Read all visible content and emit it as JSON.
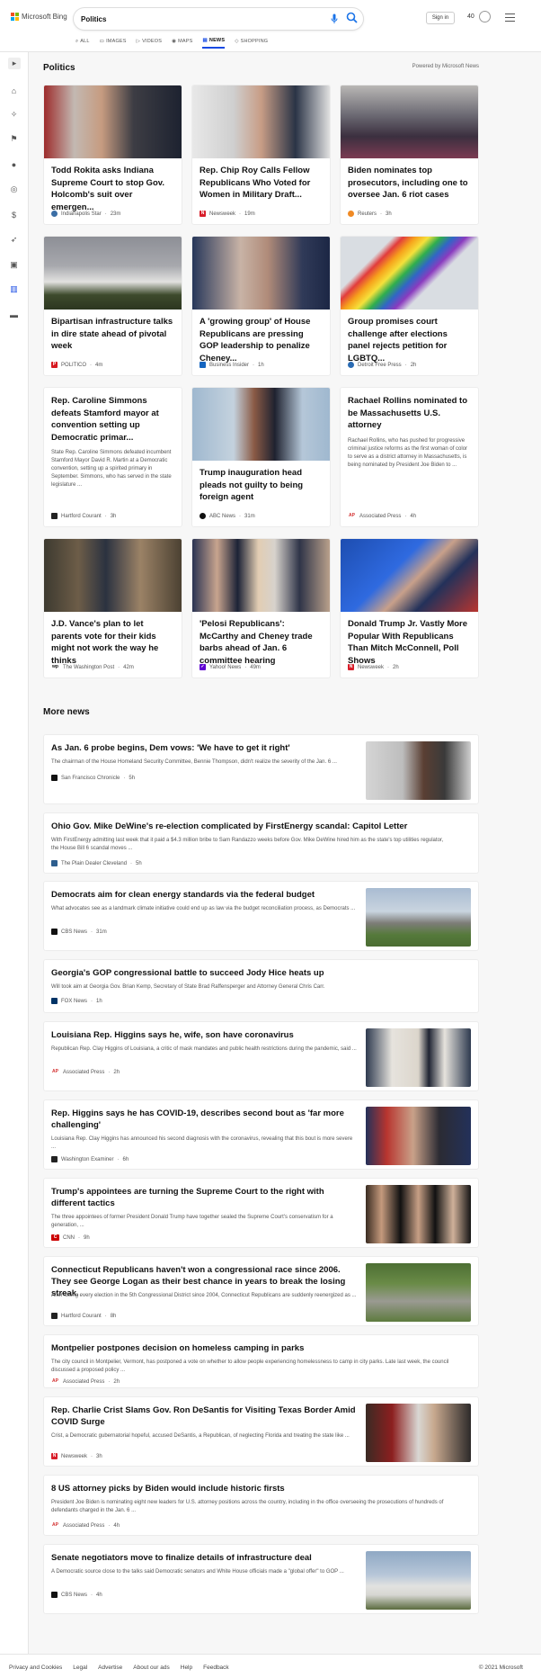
{
  "brand": {
    "name": "Microsoft Bing"
  },
  "search": {
    "query": "Politics"
  },
  "header": {
    "sign_in": "Sign in",
    "rewards_points": "40"
  },
  "tabs": [
    {
      "label": "ALL"
    },
    {
      "label": "IMAGES"
    },
    {
      "label": "VIDEOS"
    },
    {
      "label": "MAPS"
    },
    {
      "label": "NEWS",
      "active": true
    },
    {
      "label": "SHOPPING"
    }
  ],
  "section": {
    "title": "Politics",
    "powered_by": "Powered by Microsoft News"
  },
  "cards": [
    {
      "title": "Todd Rokita asks Indiana Supreme Court to stop Gov. Holcomb's suit over emergen...",
      "source": "Indianapolis Star",
      "time": "23m"
    },
    {
      "title": "Rep. Chip Roy Calls Fellow Republicans Who Voted for Women in Military Draft...",
      "source": "Newsweek",
      "time": "19m"
    },
    {
      "title": "Biden nominates top prosecutors, including one to oversee Jan. 6 riot cases",
      "source": "Reuters",
      "time": "3h"
    },
    {
      "title": "Bipartisan infrastructure talks in dire state ahead of pivotal week",
      "source": "POLITICO",
      "time": "4m"
    },
    {
      "title": "A 'growing group' of House Republicans are pressing GOP leadership to penalize Cheney...",
      "source": "Business Insider",
      "time": "1h"
    },
    {
      "title": "Group promises court challenge after elections panel rejects petition for LGBTQ...",
      "source": "Detroit Free Press",
      "time": "2h"
    },
    {
      "title": "Rep. Caroline Simmons defeats Stamford mayor at convention setting up Democratic primar...",
      "desc": "State Rep. Caroline Simmons defeated incumbent Stamford Mayor David R. Martin at a Democratic convention, setting up a spirited primary in September. Simmons, who has served in the state legislature ...",
      "source": "Hartford Courant",
      "time": "3h"
    },
    {
      "title": "Trump inauguration head pleads not guilty to being foreign agent",
      "source": "ABC News",
      "time": "31m"
    },
    {
      "title": "Rachael Rollins nominated to be Massachusetts U.S. attorney",
      "desc": "Rachael Rollins, who has pushed for progressive criminal justice reforms as the first woman of color to serve as a district attorney in Massachusetts, is being nominated by President Joe Biden to ...",
      "source": "Associated Press",
      "time": "4h"
    },
    {
      "title": "J.D. Vance's plan to let parents vote for their kids might not work the way he thinks",
      "source": "The Washington Post",
      "time": "42m"
    },
    {
      "title": "'Pelosi Republicans': McCarthy and Cheney trade barbs ahead of Jan. 6 committee hearing",
      "source": "Yahoo! News",
      "time": "49m"
    },
    {
      "title": "Donald Trump Jr. Vastly More Popular With Republicans Than Mitch McConnell, Poll Shows",
      "source": "Newsweek",
      "time": "2h"
    }
  ],
  "more_news": {
    "title": "More news",
    "items": [
      {
        "title": "As Jan. 6 probe begins, Dem vows: 'We have to get it right'",
        "desc": "The chairman of the House Homeland Security Committee, Bennie Thompson, didn't realize the severity of the Jan. 6 ...",
        "source": "San Francisco Chronicle",
        "time": "5h"
      },
      {
        "title": "Ohio Gov. Mike DeWine's re-election complicated by FirstEnergy scandal: Capitol Letter",
        "desc": "With FirstEnergy admitting last week that it paid a $4.3 million bribe to Sam Randazzo weeks before Gov. Mike DeWine hired him as the state's top utilities regulator, the House Bill 6 scandal moves ...",
        "source": "The Plain Dealer Cleveland",
        "time": "5h"
      },
      {
        "title": "Democrats aim for clean energy standards via the federal budget",
        "desc": "What advocates see as a landmark climate initiative could end up as law via the budget reconciliation process, as Democrats ...",
        "source": "CBS News",
        "time": "31m"
      },
      {
        "title": "Georgia's GOP congressional battle to succeed Jody Hice heats up",
        "desc": "Will took aim at Georgia Gov. Brian Kemp, Secretary of State Brad Raffensperger and Attorney General Chris Carr.",
        "source": "FOX News",
        "time": "1h"
      },
      {
        "title": "Louisiana Rep. Higgins says he, wife, son have coronavirus",
        "desc": "Republican Rep. Clay Higgins of Louisiana, a critic of mask mandates and public health restrictions during the pandemic, said ...",
        "source": "Associated Press",
        "time": "2h"
      },
      {
        "title": "Rep. Higgins says he has COVID-19, describes second bout as 'far more challenging'",
        "desc": "Louisiana Rep. Clay Higgins has announced his second diagnosis with the coronavirus, revealing that this bout is more severe ...",
        "source": "Washington Examiner",
        "time": "6h"
      },
      {
        "title": "Trump's appointees are turning the Supreme Court to the right with different tactics",
        "desc": "The three appointees of former President Donald Trump have together sealed the Supreme Court's conservatism for a generation, ...",
        "source": "CNN",
        "time": "9h"
      },
      {
        "title": "Connecticut Republicans haven't won a congressional race since 2006. They see George Logan as their best chance in years to break the losing streak.",
        "desc": "After losing every election in the 5th Congressional District since 2004, Connecticut Republicans are suddenly reenergized as ...",
        "source": "Hartford Courant",
        "time": "8h"
      },
      {
        "title": "Montpelier postpones decision on homeless camping in parks",
        "desc": "The city council in Montpelier, Vermont, has postponed a vote on whether to allow people experiencing homelessness to camp in city parks. Late last week, the council discussed a proposed policy ...",
        "source": "Associated Press",
        "time": "2h"
      },
      {
        "title": "Rep. Charlie Crist Slams Gov. Ron DeSantis for Visiting Texas Border Amid COVID Surge",
        "desc": "Crist, a Democratic gubernatorial hopeful, accused DeSantis, a Republican, of neglecting Florida and treating the state like ...",
        "source": "Newsweek",
        "time": "3h"
      },
      {
        "title": "8 US attorney picks by Biden would include historic firsts",
        "desc": "President Joe Biden is nominating eight new leaders for U.S. attorney positions across the country, including in the office overseeing the prosecutions of hundreds of defendants charged in the Jan. 6 ...",
        "source": "Associated Press",
        "time": "4h"
      },
      {
        "title": "Senate negotiators move to finalize details of infrastructure deal",
        "desc": "A Democratic source close to the talks said Democratic senators and White House officials made a \"global offer\" to GOP ...",
        "source": "CBS News",
        "time": "4h"
      }
    ]
  },
  "footer": {
    "links": [
      "Privacy and Cookies",
      "Legal",
      "Advertise",
      "About our ads",
      "Help",
      "Feedback"
    ],
    "copyright": "© 2021 Microsoft"
  }
}
